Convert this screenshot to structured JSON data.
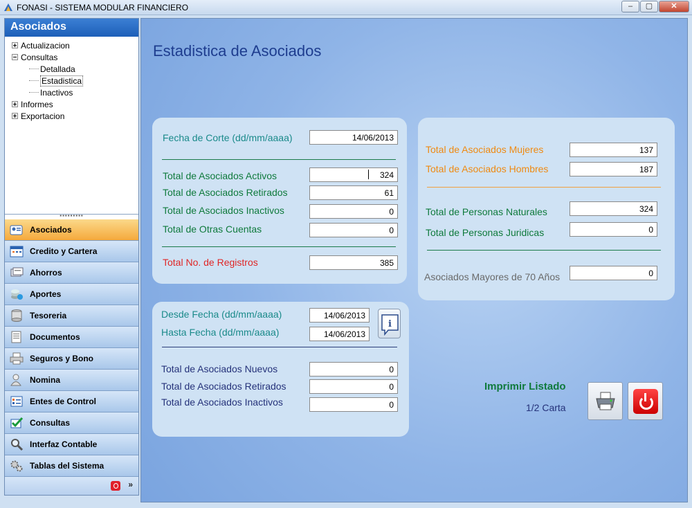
{
  "window": {
    "title": "FONASI - SISTEMA MODULAR FINANCIERO",
    "buttons": {
      "minimize": "‒",
      "maximize": "▢",
      "close": "✕"
    }
  },
  "sidebar": {
    "header": "Asociados",
    "tree": {
      "actualizacion": "Actualizacion",
      "consultas": "Consultas",
      "detallada": "Detallada",
      "estadistica": "Estadistica",
      "inactivos": "Inactivos",
      "informes": "Informes",
      "exportacion": "Exportacion"
    },
    "grip": "▪▪▪▪▪▪▪▪▪",
    "nav": [
      {
        "label": "Asociados",
        "icon": "associates-card-icon"
      },
      {
        "label": "Credito y Cartera",
        "icon": "calendar-icon"
      },
      {
        "label": "Ahorros",
        "icon": "savings-icon"
      },
      {
        "label": "Aportes",
        "icon": "coins-icon"
      },
      {
        "label": "Tesoreria",
        "icon": "database-icon"
      },
      {
        "label": "Documentos",
        "icon": "documents-icon"
      },
      {
        "label": "Seguros y Bono",
        "icon": "printer-icon"
      },
      {
        "label": "Nomina",
        "icon": "person-icon"
      },
      {
        "label": "Entes de Control",
        "icon": "checklist-icon"
      },
      {
        "label": "Consultas",
        "icon": "check-icon"
      },
      {
        "label": "Interfaz Contable",
        "icon": "magnifier-icon"
      },
      {
        "label": "Tablas del Sistema",
        "icon": "gears-icon"
      }
    ],
    "footer_arrow": "»"
  },
  "main": {
    "title": "Estadistica de Asociados",
    "panel1": {
      "fecha_corte_label": "Fecha de Corte (dd/mm/aaaa)",
      "fecha_corte_value": "14/06/2013",
      "activos_label": "Total de Asociados Activos",
      "activos_value": "324",
      "retirados_label": "Total de Asociados Retirados",
      "retirados_value": "61",
      "inactivos_label": "Total de Asociados Inactivos",
      "inactivos_value": "0",
      "otras_label": "Total de Otras Cuentas",
      "otras_value": "0",
      "registros_label": "Total No. de Registros",
      "registros_value": "385"
    },
    "panel2": {
      "mujeres_label": "Total de Asociados Mujeres",
      "mujeres_value": "137",
      "hombres_label": "Total de Asociados Hombres",
      "hombres_value": "187",
      "naturales_label": "Total de Personas Naturales",
      "naturales_value": "324",
      "juridicas_label": "Total de Personas Juridicas",
      "juridicas_value": "0",
      "mayores_label": "Asociados Mayores de 70 Años",
      "mayores_value": "0"
    },
    "panel3": {
      "desde_label": "Desde Fecha (dd/mm/aaaa)",
      "desde_value": "14/06/2013",
      "hasta_label": "Hasta Fecha (dd/mm/aaaa)",
      "hasta_value": "14/06/2013",
      "info_button": "i",
      "nuevos_label": "Total de Asociados Nuevos",
      "nuevos_value": "0",
      "retirados_label": "Total de Asociados Retirados",
      "retirados_value": "0",
      "inactivos_label": "Total de Asociados Inactivos",
      "inactivos_value": "0"
    },
    "print": {
      "label": "Imprimir Listado",
      "paper": "1/2 Carta"
    }
  },
  "colors": {
    "teal": "#1a8a8a",
    "green": "#0f7a3c",
    "red": "#e02626",
    "orange": "#ef8a12",
    "navy": "#25327a",
    "active_nav": "#f5a93c"
  }
}
